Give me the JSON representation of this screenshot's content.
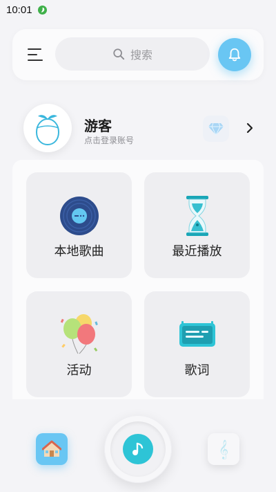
{
  "status_bar": {
    "time": "10:01"
  },
  "header": {
    "search_placeholder": "搜索"
  },
  "profile": {
    "name": "游客",
    "login_hint": "点击登录账号"
  },
  "tiles": [
    {
      "label": "本地歌曲",
      "icon": "vinyl-disc-icon"
    },
    {
      "label": "最近播放",
      "icon": "hourglass-icon"
    },
    {
      "label": "活动",
      "icon": "balloons-icon"
    },
    {
      "label": "歌词",
      "icon": "lyrics-screen-icon"
    }
  ],
  "bottom_nav": {
    "items": [
      {
        "icon": "home-icon"
      },
      {
        "icon": "music-note-icon"
      },
      {
        "icon": "treble-clef-icon",
        "glyph": "𝄞"
      }
    ]
  },
  "colors": {
    "accent": "#69c6f3",
    "teal": "#2ec4d6",
    "background": "#f4f4f7",
    "tile": "#eeeef1"
  }
}
